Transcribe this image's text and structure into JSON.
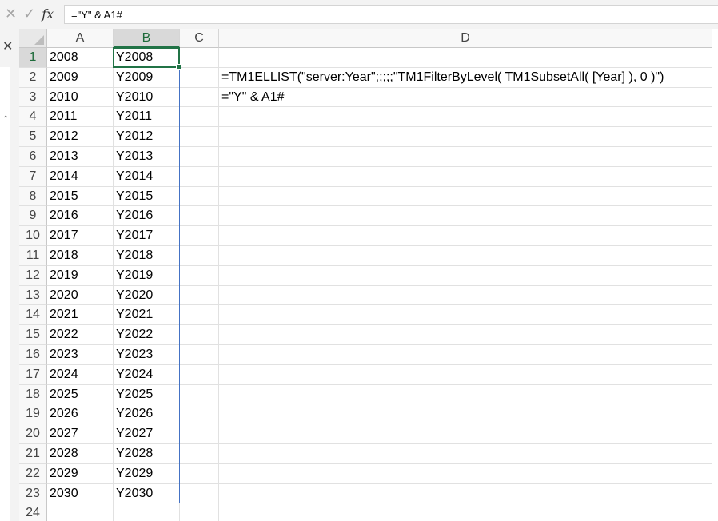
{
  "formula_bar": {
    "cancel_icon": "cancel-x-icon",
    "confirm_icon": "check-icon",
    "fx_label": "fx",
    "formula": "=\"Y\" & A1#"
  },
  "columns": [
    "A",
    "B",
    "C",
    "D"
  ],
  "selected_column": "B",
  "rows": [
    {
      "n": "1",
      "a": "2008",
      "b": "Y2008",
      "d": ""
    },
    {
      "n": "2",
      "a": "2009",
      "b": "Y2009",
      "d": "=TM1ELLIST(\"server:Year\";;;;;\"TM1FilterByLevel( TM1SubsetAll( [Year] ), 0 )\")"
    },
    {
      "n": "3",
      "a": "2010",
      "b": "Y2010",
      "d": "=\"Y\" & A1#"
    },
    {
      "n": "4",
      "a": "2011",
      "b": "Y2011",
      "d": ""
    },
    {
      "n": "5",
      "a": "2012",
      "b": "Y2012",
      "d": ""
    },
    {
      "n": "6",
      "a": "2013",
      "b": "Y2013",
      "d": ""
    },
    {
      "n": "7",
      "a": "2014",
      "b": "Y2014",
      "d": ""
    },
    {
      "n": "8",
      "a": "2015",
      "b": "Y2015",
      "d": ""
    },
    {
      "n": "9",
      "a": "2016",
      "b": "Y2016",
      "d": ""
    },
    {
      "n": "10",
      "a": "2017",
      "b": "Y2017",
      "d": ""
    },
    {
      "n": "11",
      "a": "2018",
      "b": "Y2018",
      "d": ""
    },
    {
      "n": "12",
      "a": "2019",
      "b": "Y2019",
      "d": ""
    },
    {
      "n": "13",
      "a": "2020",
      "b": "Y2020",
      "d": ""
    },
    {
      "n": "14",
      "a": "2021",
      "b": "Y2021",
      "d": ""
    },
    {
      "n": "15",
      "a": "2022",
      "b": "Y2022",
      "d": ""
    },
    {
      "n": "16",
      "a": "2023",
      "b": "Y2023",
      "d": ""
    },
    {
      "n": "17",
      "a": "2024",
      "b": "Y2024",
      "d": ""
    },
    {
      "n": "18",
      "a": "2025",
      "b": "Y2025",
      "d": ""
    },
    {
      "n": "19",
      "a": "2026",
      "b": "Y2026",
      "d": ""
    },
    {
      "n": "20",
      "a": "2027",
      "b": "Y2027",
      "d": ""
    },
    {
      "n": "21",
      "a": "2028",
      "b": "Y2028",
      "d": ""
    },
    {
      "n": "22",
      "a": "2029",
      "b": "Y2029",
      "d": ""
    },
    {
      "n": "23",
      "a": "2030",
      "b": "Y2030",
      "d": ""
    },
    {
      "n": "24",
      "a": "",
      "b": "",
      "d": ""
    }
  ],
  "colors": {
    "accent_green": "#217346",
    "spill_blue": "#4472c4"
  }
}
